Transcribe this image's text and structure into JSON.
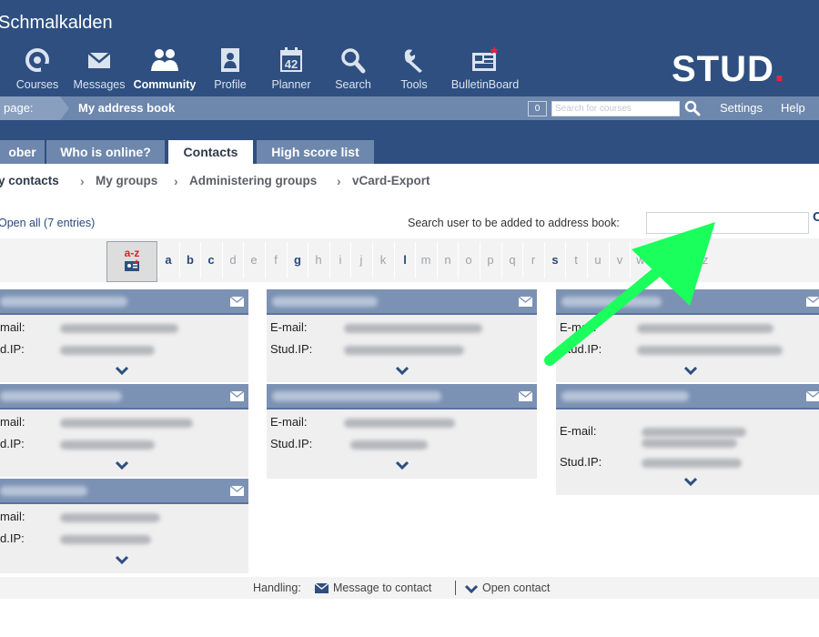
{
  "header": {
    "site_title": "Schmalkalden",
    "logo_text": "STUD",
    "logo_dot": ".",
    "nav": [
      {
        "label": "Courses",
        "icon": "courses-icon"
      },
      {
        "label": "Messages",
        "icon": "envelope-icon"
      },
      {
        "label": "Community",
        "icon": "community-icon",
        "active": true
      },
      {
        "label": "Profile",
        "icon": "profile-icon"
      },
      {
        "label": "Planner",
        "icon": "calendar-icon",
        "calendar_day": "42"
      },
      {
        "label": "Search",
        "icon": "magnifier-icon"
      },
      {
        "label": "Tools",
        "icon": "wrench-icon"
      },
      {
        "label": "BulletinBoard",
        "icon": "bulletin-board-icon"
      }
    ]
  },
  "context_bar": {
    "label": "page:",
    "current_page": "My address book",
    "count": "0",
    "search_placeholder": "Search for courses",
    "settings": "Settings",
    "help": "Help"
  },
  "tabs": [
    "ober",
    "Who is online?",
    "Contacts",
    "High score list"
  ],
  "active_tab": "Contacts",
  "subnav": [
    "y contacts",
    "My groups",
    "Administering groups",
    "vCard-Export"
  ],
  "options": {
    "open_all": "Open all (7 entries)",
    "search_label": "Search user to be added to address book:",
    "search_go": "C"
  },
  "alphabet": {
    "button_label": "a-z",
    "letters": [
      "a",
      "b",
      "c",
      "d",
      "e",
      "f",
      "g",
      "h",
      "i",
      "j",
      "k",
      "l",
      "m",
      "n",
      "o",
      "p",
      "q",
      "r",
      "s",
      "t",
      "u",
      "v",
      "w",
      "x",
      "y",
      "z"
    ],
    "enabled": [
      "a",
      "b",
      "c",
      "g",
      "l",
      "s"
    ]
  },
  "cards": {
    "email_label": "E-mail:",
    "studip_label": "Stud.IP:",
    "email_label_cut": "mail:",
    "studip_label_cut": "d.IP:"
  },
  "footer": {
    "label": "Handling:",
    "message": "Message to contact",
    "open": "Open contact"
  },
  "colors": {
    "header_bg": "#2e4f80",
    "context_bar_bg": "#6e87ac",
    "card_header_bg": "#7c92b4",
    "accent_red": "#e8233f",
    "annotation_arrow": "#1aff5c"
  }
}
